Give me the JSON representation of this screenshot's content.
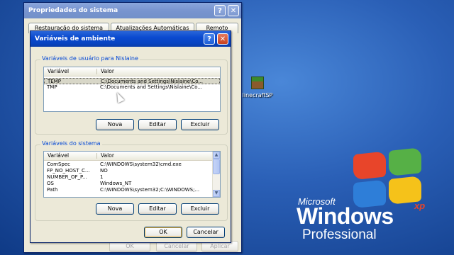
{
  "desktop": {
    "icon_label": "linecraftSP",
    "logo": {
      "microsoft": "Microsoft",
      "windows": "Windows",
      "xp": "xp",
      "edition": "Professional"
    }
  },
  "sys_props": {
    "title": "Propriedades do sistema",
    "help_btn": "?",
    "close_btn": "✕",
    "tabs": [
      "Restauração do sistema",
      "Atualizações Automáticas",
      "Remoto"
    ],
    "bottom_buttons": [
      "OK",
      "Cancelar",
      "Aplicar"
    ]
  },
  "env_dialog": {
    "title": "Variáveis de ambiente",
    "help_btn": "?",
    "close_btn": "✕",
    "user_group_label": "Variáveis de usuário para Nislaine",
    "sys_group_label": "Variáveis do sistema",
    "columns": {
      "name": "Variável",
      "value": "Valor"
    },
    "user_vars": [
      {
        "name": "TEMP",
        "value": "C:\\Documents and Settings\\Nislaine\\Co..."
      },
      {
        "name": "TMP",
        "value": "C:\\Documents and Settings\\Nislaine\\Co..."
      }
    ],
    "sys_vars": [
      {
        "name": "ComSpec",
        "value": "C:\\WINDOWS\\system32\\cmd.exe"
      },
      {
        "name": "FP_NO_HOST_C...",
        "value": "NO"
      },
      {
        "name": "NUMBER_OF_P...",
        "value": "1"
      },
      {
        "name": "OS",
        "value": "Windows_NT"
      },
      {
        "name": "Path",
        "value": "C:\\WINDOWS\\system32;C:\\WINDOWS;..."
      }
    ],
    "buttons": {
      "new": "Nova",
      "edit": "Editar",
      "delete": "Excluir",
      "ok": "OK",
      "cancel": "Cancelar"
    },
    "scroll": {
      "up": "▲",
      "down": "▼"
    }
  },
  "colors": {
    "title_active": "#0a4ad0",
    "dialog_bg": "#ece9d8",
    "group_label": "#0046d5",
    "selection": "#d8d7c8"
  }
}
